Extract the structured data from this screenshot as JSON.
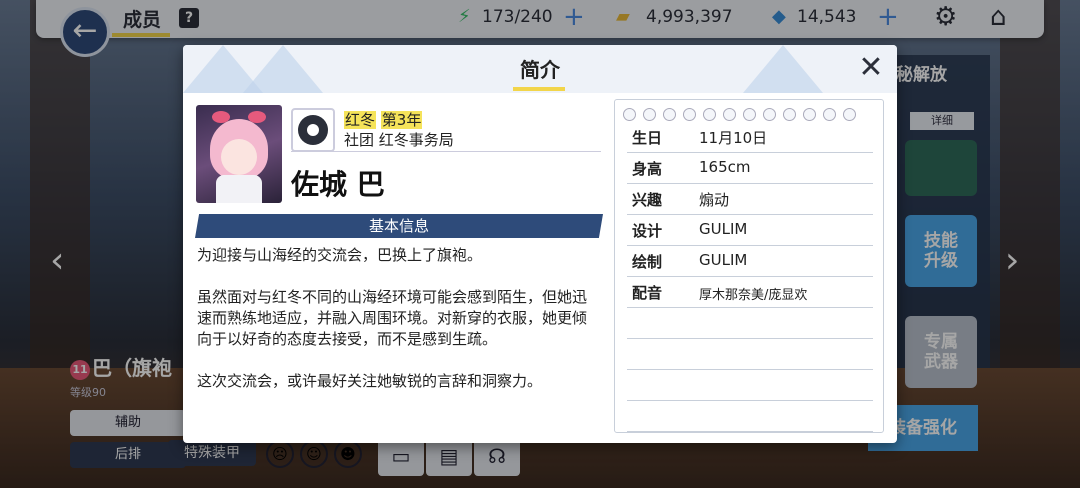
{
  "topbar": {
    "title": "成员",
    "help_label": "?",
    "stamina": "173/240",
    "credits": "4,993,397",
    "gems": "14,543"
  },
  "background": {
    "right_top_label": "秘解放",
    "detail_tab": "详细",
    "btn_skill": "技能\n升级",
    "btn_weapon": "专属\n武器",
    "btn_enhance": "装备强化",
    "char_name": "巴（旗袍",
    "char_level": "等级90",
    "char_heart": "11",
    "role_support": "辅助",
    "role_back": "后排",
    "armor_tag": "特殊装甲"
  },
  "modal": {
    "title": "简介",
    "school": "红冬",
    "grade": "第3年",
    "club_prefix": "社团",
    "club": "红冬事务局",
    "name": "佐城 巴",
    "section_title": "基本信息",
    "description": [
      "为迎接与山海经的交流会，巴换上了旗袍。",
      "虽然面对与红冬不同的山海经环境可能会感到陌生，但她迅速而熟练地适应，并融入周围环境。对新穿的衣服，她更倾向于以好奇的态度去接受，而不是感到生疏。",
      "这次交流会，或许最好关注她敏锐的言辞和洞察力。"
    ],
    "profile": [
      {
        "key": "生日",
        "value": "11月10日"
      },
      {
        "key": "身高",
        "value": "165cm"
      },
      {
        "key": "兴趣",
        "value": "煽动"
      },
      {
        "key": "设计",
        "value": "GULIM"
      },
      {
        "key": "绘制",
        "value": "GULIM"
      },
      {
        "key": "配音",
        "value": "厚木那奈美/庞显欢"
      }
    ]
  },
  "colors": {
    "accent_yellow": "#f2d54a",
    "header_navy": "#2e4b7a",
    "button_blue": "#4aa6e8"
  },
  "icons": [
    "back-arrow-icon",
    "help-icon",
    "stamina-icon",
    "credits-icon",
    "gem-icon",
    "plus-icon",
    "gear-icon",
    "home-icon",
    "close-icon",
    "club-gear-icon"
  ]
}
